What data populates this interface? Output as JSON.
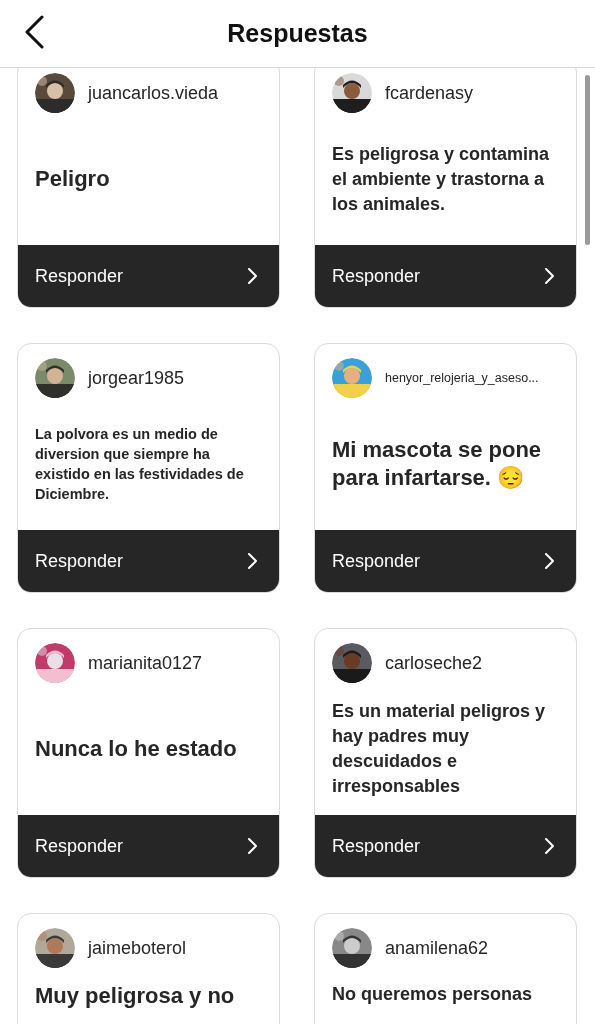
{
  "header": {
    "title": "Respuestas"
  },
  "cards": [
    {
      "username": "juancarlos.vieda",
      "text": "Peligro",
      "kind": "large",
      "button": "Responder"
    },
    {
      "username": "fcardenasy",
      "text": "Es peligrosa y contamina el ambiente y trastorna a los animales.",
      "kind": "medium",
      "button": "Responder"
    },
    {
      "username": "jorgear1985",
      "text": "La polvora es un medio de diversion que siempre ha existido en las festividades de Diciembre.",
      "kind": "small",
      "button": "Responder"
    },
    {
      "username": "henyor_relojeria_y_aseso...",
      "text": "Mi mascota se pone para infartarse. 😔",
      "kind": "large",
      "button": "Responder"
    },
    {
      "username": "marianita0127",
      "text": "Nunca lo he estado",
      "kind": "large",
      "button": "Responder"
    },
    {
      "username": "carloseche2",
      "text": "Es un material peligros y hay padres muy descuidados e irresponsables",
      "kind": "medium",
      "button": "Responder"
    },
    {
      "username": "jaimeboterol",
      "text": "Muy peligrosa y no",
      "kind": "large"
    },
    {
      "username": "anamilena62",
      "text": "No queremos personas",
      "kind": "medium"
    }
  ]
}
